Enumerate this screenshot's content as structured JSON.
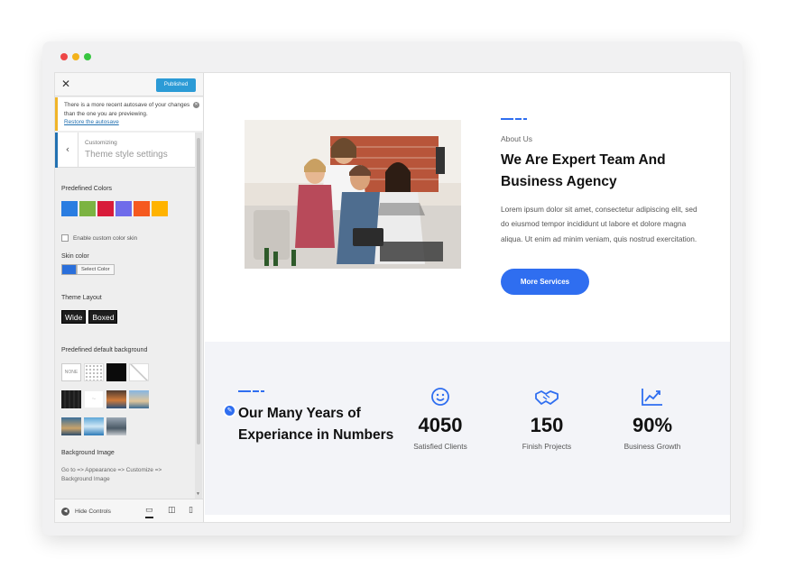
{
  "sidebar": {
    "close_glyph": "✕",
    "publish_label": "Published",
    "notice": {
      "text": "There is a more recent autosave of your changes than the one you are previewing.",
      "link": "Restore the autosave"
    },
    "section": {
      "subtitle": "Customizing",
      "title": "Theme style settings"
    },
    "predefined_colors": {
      "label": "Predefined Colors",
      "colors": [
        "#2a7de1",
        "#7cb342",
        "#d81b3a",
        "#6f6bea",
        "#f5591f",
        "#ffb300"
      ]
    },
    "custom_skin_label": "Enable custom color skin",
    "skin_color": {
      "label": "Skin color",
      "value": "#2a6fdb",
      "button": "Select Color"
    },
    "theme_layout": {
      "label": "Theme Layout",
      "options": [
        "Wide",
        "Boxed"
      ]
    },
    "default_background": {
      "label": "Predefined default background",
      "none_label": "NONE"
    },
    "background_image": {
      "label": "Background Image",
      "help": "Go to => Appearance => Customize => Background Image"
    },
    "hide_controls": "Hide Controls"
  },
  "about": {
    "label": "About Us",
    "title": "We Are Expert Team And Business Agency",
    "text": "Lorem ipsum dolor sit amet, consectetur adipiscing elit, sed do eiusmod tempor incididunt ut labore et dolore magna aliqua. Ut enim ad minim veniam, quis nostrud exercitation.",
    "button": "More Services"
  },
  "stats": {
    "title": "Our Many Years of Experiance in Numbers",
    "items": [
      {
        "icon": "smile-icon",
        "value": "4050",
        "label": "Satisfied Clients"
      },
      {
        "icon": "handshake-icon",
        "value": "150",
        "label": "Finish Projects"
      },
      {
        "icon": "trend-chart-icon",
        "value": "90%",
        "label": "Business Growth"
      }
    ]
  },
  "colors": {
    "accent": "#2f6ef0",
    "notice_border": "#f0b429",
    "publish": "#2c9bd6"
  }
}
